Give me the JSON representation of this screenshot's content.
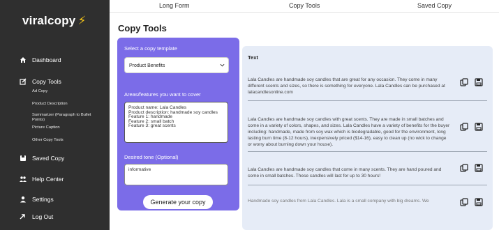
{
  "app": {
    "logo_text": "viralcopy",
    "logo_icon": "lightning-bolt-icon"
  },
  "sidebar": {
    "items": [
      {
        "label": "Dashboard",
        "icon": "home-icon"
      },
      {
        "label": "Copy Tools",
        "icon": "edit-icon"
      },
      {
        "label": "Saved Copy",
        "icon": "save-icon"
      },
      {
        "label": "Help Center",
        "icon": "users-icon"
      },
      {
        "label": "Settings",
        "icon": "person-icon"
      },
      {
        "label": "Log Out",
        "icon": "logout-arrow-icon"
      }
    ],
    "subitems": [
      "Ad Copy",
      "Product Description",
      "Summarizer (Paragraph to Bullet Points)",
      "Picture Caption",
      "Other Copy Tools"
    ]
  },
  "topnav": {
    "tabs": [
      "Long Form",
      "Copy Tools",
      "Saved Copy"
    ]
  },
  "page": {
    "title": "Copy Tools"
  },
  "form": {
    "template_label": "Select a copy template",
    "template_value": "Product Benefits",
    "features_label": "Areas/features you want to cover",
    "features_value": "Product name: Lala Candles\nProduct description: handmade soy candles\nFeature 1: handmade\nFeature 2: small batch\nFeature 3: great scents",
    "tone_label": "Desired tone (Optional)",
    "tone_value": "informative",
    "generate_label": "Generate your copy"
  },
  "results": {
    "heading": "Text",
    "items": [
      "Lala Candles are handmade soy candles that are great for any occasion. They come in many different scents and sizes, so there is something for everyone. Lala Candles can be purchased at lalacandlesonline.com",
      "Lala Candles are handmade soy candles with great scents. They are made in small batches and come in a variety of colors, shapes, and sizes. Lala Candles have a variety of benefits for the buyer including: handmade, made from soy wax which is biodegradable, good for the environment, long lasting burn time (8-12 hours), inexpensively priced ($14-16), easy to clean up (no wick to change or worry about burning down your house).",
      "Lala Candles are handmade soy candles that come in many scents. They are hand poured and come in small batches. These candles will last for up to 30 hours!",
      "Handmade soy candles from Lala Candles. Lala is a small company with big dreams. We"
    ],
    "copy_icon": "copy-icon",
    "save_icon": "save-disk-icon"
  }
}
